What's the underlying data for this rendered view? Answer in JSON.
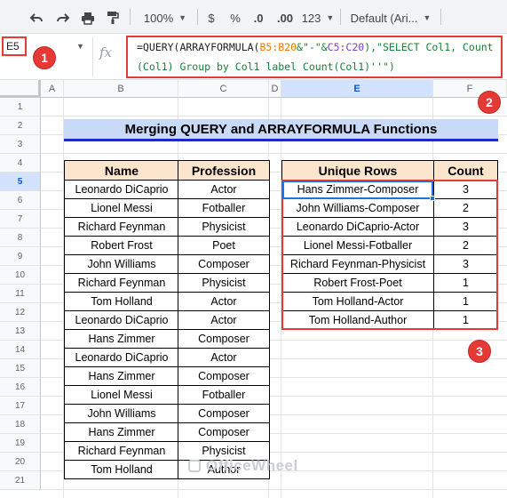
{
  "toolbar": {
    "zoom": "100%",
    "currency": "$",
    "percent": "%",
    "dec_decrease": ".0",
    "dec_increase": ".00",
    "more_formats": "123",
    "font": "Default (Ari..."
  },
  "formula_bar": {
    "cell_ref": "E5",
    "fx": "fx",
    "formula_line1_a": "=QUERY(ARRAYFORMULA(",
    "formula_ref1": "B5:B20",
    "formula_line1_b": "&\"-\"&",
    "formula_ref2": "C5:C20",
    "formula_line1_c": "),\"SELECT Col1, Count",
    "formula_line2": "(Col1) Group by Col1 label Count(Col1)''\")"
  },
  "badges": [
    "1",
    "2",
    "3"
  ],
  "columns": [
    "A",
    "B",
    "C",
    "D",
    "E",
    "F"
  ],
  "rows": [
    "1",
    "2",
    "3",
    "4",
    "5",
    "6",
    "7",
    "8",
    "9",
    "10",
    "11",
    "12",
    "13",
    "14",
    "15",
    "16",
    "17",
    "18",
    "19",
    "20",
    "21"
  ],
  "title": "Merging QUERY and ARRAYFORMULA Functions",
  "source_table": {
    "headers": [
      "Name",
      "Profession"
    ],
    "rows": [
      [
        "Leonardo DiCaprio",
        "Actor"
      ],
      [
        "Lionel Messi",
        "Fotballer"
      ],
      [
        "Richard Feynman",
        "Physicist"
      ],
      [
        "Robert Frost",
        "Poet"
      ],
      [
        "John Williams",
        "Composer"
      ],
      [
        "Richard Feynman",
        "Physicist"
      ],
      [
        "Tom Holland",
        "Actor"
      ],
      [
        "Leonardo DiCaprio",
        "Actor"
      ],
      [
        "Hans Zimmer",
        "Composer"
      ],
      [
        "Leonardo DiCaprio",
        "Actor"
      ],
      [
        "Hans Zimmer",
        "Composer"
      ],
      [
        "Lionel Messi",
        "Fotballer"
      ],
      [
        "John Williams",
        "Composer"
      ],
      [
        "Hans Zimmer",
        "Composer"
      ],
      [
        "Richard Feynman",
        "Physicist"
      ],
      [
        "Tom Holland",
        "Author"
      ]
    ]
  },
  "result_table": {
    "headers": [
      "Unique Rows",
      "Count"
    ],
    "rows": [
      [
        "Hans Zimmer-Composer",
        "3"
      ],
      [
        "John Williams-Composer",
        "2"
      ],
      [
        "Leonardo DiCaprio-Actor",
        "3"
      ],
      [
        "Lionel Messi-Fotballer",
        "2"
      ],
      [
        "Richard Feynman-Physicist",
        "3"
      ],
      [
        "Robert Frost-Poet",
        "1"
      ],
      [
        "Tom Holland-Actor",
        "1"
      ],
      [
        "Tom Holland-Author",
        "1"
      ]
    ]
  },
  "watermark": "OfficeWheel",
  "colors": {
    "accent_red": "#e53935",
    "header_fill": "#fce5cd",
    "title_fill": "#c9daf8",
    "title_underline": "#1a2bc7",
    "selection": "#1a73e8"
  }
}
